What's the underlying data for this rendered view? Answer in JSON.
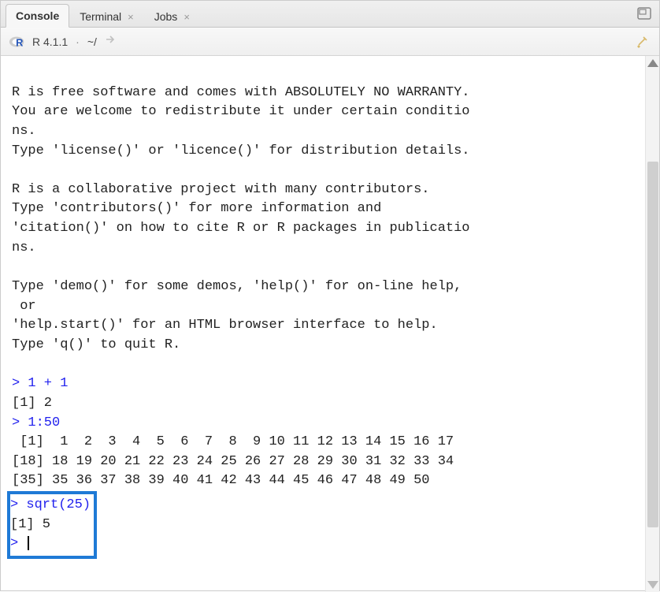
{
  "tabs": {
    "console": "Console",
    "terminal": "Terminal",
    "jobs": "Jobs"
  },
  "toolbar": {
    "version": "R 4.1.1",
    "path": "~/"
  },
  "console": {
    "startup_lines": [
      "",
      "R is free software and comes with ABSOLUTELY NO WARRANTY.",
      "You are welcome to redistribute it under certain conditio",
      "ns.",
      "Type 'license()' or 'licence()' for distribution details.",
      "",
      "R is a collaborative project with many contributors.",
      "Type 'contributors()' for more information and",
      "'citation()' on how to cite R or R packages in publicatio",
      "ns.",
      "",
      "Type 'demo()' for some demos, 'help()' for on-line help,",
      " or",
      "'help.start()' for an HTML browser interface to help.",
      "Type 'q()' to quit R.",
      ""
    ],
    "commands": [
      {
        "prompt": ">",
        "input": "1 + 1",
        "output": [
          "[1] 2"
        ]
      },
      {
        "prompt": ">",
        "input": "1:50",
        "output": [
          " [1]  1  2  3  4  5  6  7  8  9 10 11 12 13 14 15 16 17",
          "[18] 18 19 20 21 22 23 24 25 26 27 28 29 30 31 32 33 34",
          "[35] 35 36 37 38 39 40 41 42 43 44 45 46 47 48 49 50"
        ]
      }
    ],
    "highlighted": {
      "prompt": ">",
      "input": "sqrt(25)",
      "output": "[1] 5",
      "final_prompt": ">"
    }
  }
}
